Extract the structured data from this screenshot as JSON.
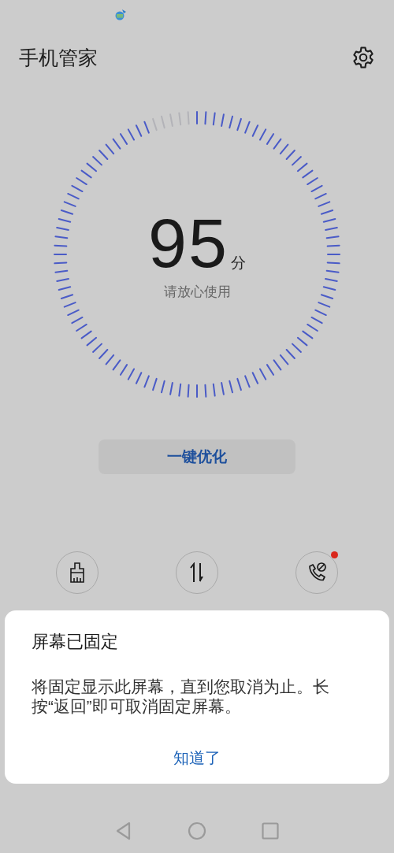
{
  "header": {
    "title": "手机管家"
  },
  "gauge": {
    "score": "95",
    "unit": "分",
    "caption": "请放心使用",
    "level": 0.95
  },
  "optimize_button": {
    "label": "一键优化"
  },
  "tools": [
    {
      "kind": "clean",
      "badge": false
    },
    {
      "kind": "traffic",
      "badge": false
    },
    {
      "kind": "block",
      "badge": true
    }
  ],
  "dialog": {
    "title": "屏幕已固定",
    "message": "将固定显示此屏幕，直到您取消为止。长按“返回”即可取消固定屏幕。",
    "button": "知道了"
  }
}
